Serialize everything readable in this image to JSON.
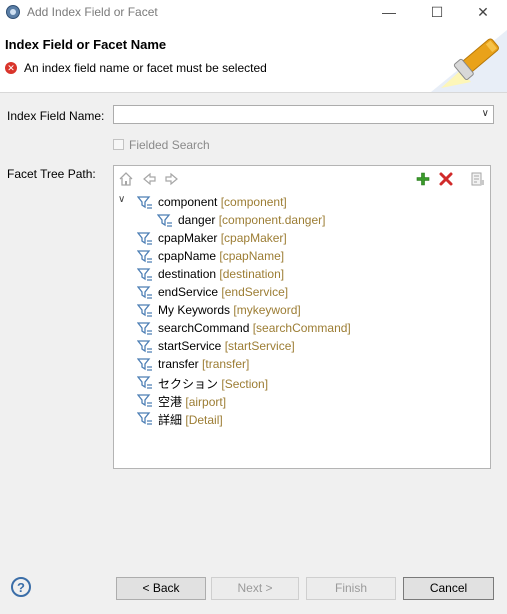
{
  "window": {
    "title": "Add Index Field or Facet",
    "minimize_glyph": "—",
    "maximize_glyph": "☐",
    "close_glyph": "✕"
  },
  "header": {
    "title": "Index Field or Facet Name",
    "error_message": "An index field name or facet must be selected"
  },
  "form": {
    "index_field_label": "Index Field Name:",
    "index_field_value": "",
    "fielded_search_label": "Fielded Search",
    "fielded_search_checked": false,
    "facet_tree_label": "Facet Tree Path:"
  },
  "toolbar_icons": [
    "home-icon",
    "back-arrow-icon",
    "forward-arrow-icon",
    "add-icon",
    "delete-icon",
    "properties-icon"
  ],
  "tree": {
    "nodes": [
      {
        "name": "component",
        "tag": "[component]",
        "expanded": true
      },
      {
        "name": "danger",
        "tag": "[component.danger]",
        "child": true
      },
      {
        "name": "cpapMaker",
        "tag": "[cpapMaker]"
      },
      {
        "name": "cpapName",
        "tag": "[cpapName]"
      },
      {
        "name": "destination",
        "tag": "[destination]"
      },
      {
        "name": "endService",
        "tag": "[endService]"
      },
      {
        "name": "My Keywords",
        "tag": "[mykeyword]"
      },
      {
        "name": "searchCommand",
        "tag": "[searchCommand]"
      },
      {
        "name": "startService",
        "tag": "[startService]"
      },
      {
        "name": "transfer",
        "tag": "[transfer]"
      },
      {
        "name": "セクション",
        "tag": "[Section]"
      },
      {
        "name": "空港",
        "tag": "[airport]"
      },
      {
        "name": "詳細",
        "tag": "[Detail]"
      }
    ]
  },
  "footer": {
    "help_glyph": "?",
    "back_label": "< Back",
    "next_label": "Next >",
    "finish_label": "Finish",
    "cancel_label": "Cancel"
  },
  "colors": {
    "tag_color": "#9c7d34",
    "error_red": "#d9342b",
    "add_green": "#3a9a2a",
    "delete_red": "#d02a2a"
  }
}
